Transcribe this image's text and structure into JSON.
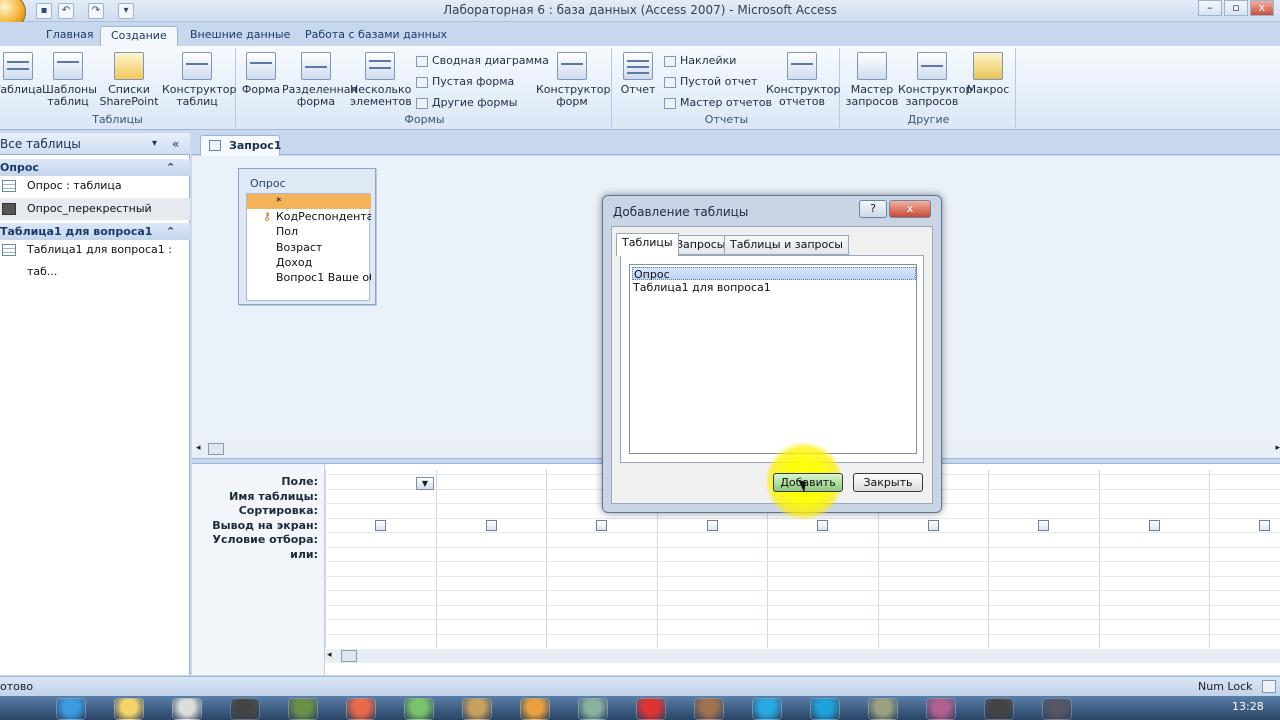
{
  "window": {
    "title": "Лабораторная 6 : база данных (Access 2007) - Microsoft Access"
  },
  "ribbon": {
    "tabs": [
      "Главная",
      "Создание",
      "Внешние данные",
      "Работа с базами данных"
    ],
    "active_tab": "Создание",
    "groups": {
      "tables": {
        "label": "Таблицы",
        "buttons": [
          "Таблица",
          "Шаблоны таблиц",
          "Списки SharePoint",
          "Конструктор таблиц"
        ]
      },
      "forms": {
        "label": "Формы",
        "buttons": [
          "Форма",
          "Разделенная форма",
          "Несколько элементов"
        ],
        "small": [
          "Сводная диаграмма",
          "Пустая форма",
          "Другие формы"
        ],
        "designer": "Конструктор форм"
      },
      "reports": {
        "label": "Отчеты",
        "report": "Отчет",
        "small": [
          "Наклейки",
          "Пустой отчет",
          "Мастер отчетов"
        ],
        "designer": "Конструктор отчетов"
      },
      "other": {
        "label": "Другие",
        "buttons": [
          "Мастер запросов",
          "Конструктор запросов",
          "Макрос"
        ]
      }
    }
  },
  "nav": {
    "header": "Все таблицы",
    "groups": [
      {
        "name": "Опрос",
        "items": [
          "Опрос : таблица",
          "Опрос_перекрестный"
        ]
      },
      {
        "name": "Таблица1 для вопроса1",
        "items": [
          "Таблица1 для вопроса1 : таб..."
        ]
      }
    ]
  },
  "document": {
    "tab": "Запрос1",
    "table": {
      "name": "Опрос",
      "fields": [
        "*",
        "КодРеспондента",
        "Пол",
        "Возраст",
        "Доход",
        "Вопрос1 Ваше об"
      ]
    },
    "grid_rows": [
      "Поле:",
      "Имя таблицы:",
      "Сортировка:",
      "Вывод на экран:",
      "Условие отбора:",
      "или:"
    ]
  },
  "dialog": {
    "title": "Добавление таблицы",
    "help": "?",
    "close": "x",
    "tabs": [
      "Таблицы",
      "Запросы",
      "Таблицы и запросы"
    ],
    "list": [
      "Опрос",
      "Таблица1 для вопроса1"
    ],
    "selected": "Опрос",
    "add_button": "Добавить",
    "close_button": "Закрыть"
  },
  "status": {
    "left": "отово",
    "right": "Num Lock"
  },
  "taskbar": {
    "clock": "13:28"
  }
}
